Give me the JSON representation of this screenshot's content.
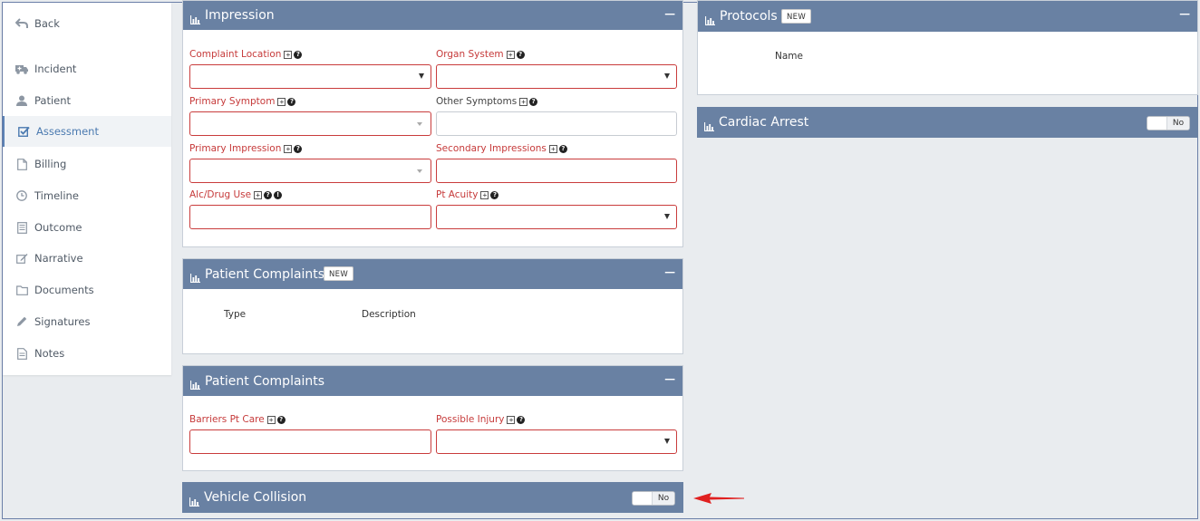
{
  "sidebar": {
    "items": [
      {
        "label": "Back",
        "icon": "back-arrow-icon"
      },
      {
        "label": "Incident",
        "icon": "ambulance-icon"
      },
      {
        "label": "Patient",
        "icon": "user-icon"
      },
      {
        "label": "Assessment",
        "icon": "checkbox-icon",
        "active": true
      },
      {
        "label": "Billing",
        "icon": "file-icon"
      },
      {
        "label": "Timeline",
        "icon": "clock-icon"
      },
      {
        "label": "Outcome",
        "icon": "document-icon"
      },
      {
        "label": "Narrative",
        "icon": "edit-icon"
      },
      {
        "label": "Documents",
        "icon": "folder-icon"
      },
      {
        "label": "Signatures",
        "icon": "pencil-icon"
      },
      {
        "label": "Notes",
        "icon": "notes-icon"
      }
    ]
  },
  "impression": {
    "title": "Impression",
    "collapse": "−",
    "fields": {
      "complaint_location": "Complaint Location",
      "organ_system": "Organ System",
      "primary_symptom": "Primary Symptom",
      "other_symptoms": "Other Symptoms",
      "primary_impression": "Primary Impression",
      "secondary_impressions": "Secondary Impressions",
      "alc_drug_use": "Alc/Drug Use",
      "pt_acuity": "Pt Acuity"
    }
  },
  "patient_complaints_list": {
    "title": "Patient Complaints",
    "badge": "NEW",
    "collapse": "−",
    "columns": [
      "Type",
      "Description"
    ]
  },
  "patient_complaints_form": {
    "title": "Patient Complaints",
    "collapse": "−",
    "fields": {
      "barriers_pt_care": "Barriers Pt Care",
      "possible_injury": "Possible Injury"
    }
  },
  "vehicle_collision": {
    "title": "Vehicle Collision",
    "toggle_value": "No"
  },
  "protocols": {
    "title": "Protocols",
    "badge": "NEW",
    "collapse": "−",
    "columns": [
      "Name"
    ]
  },
  "cardiac_arrest": {
    "title": "Cardiac Arrest",
    "toggle_value": "No"
  },
  "colors": {
    "panel_header": "#6981a3",
    "required": "#c63a3a",
    "accent": "#4b7ab0",
    "annotation_arrow": "#e02020"
  }
}
